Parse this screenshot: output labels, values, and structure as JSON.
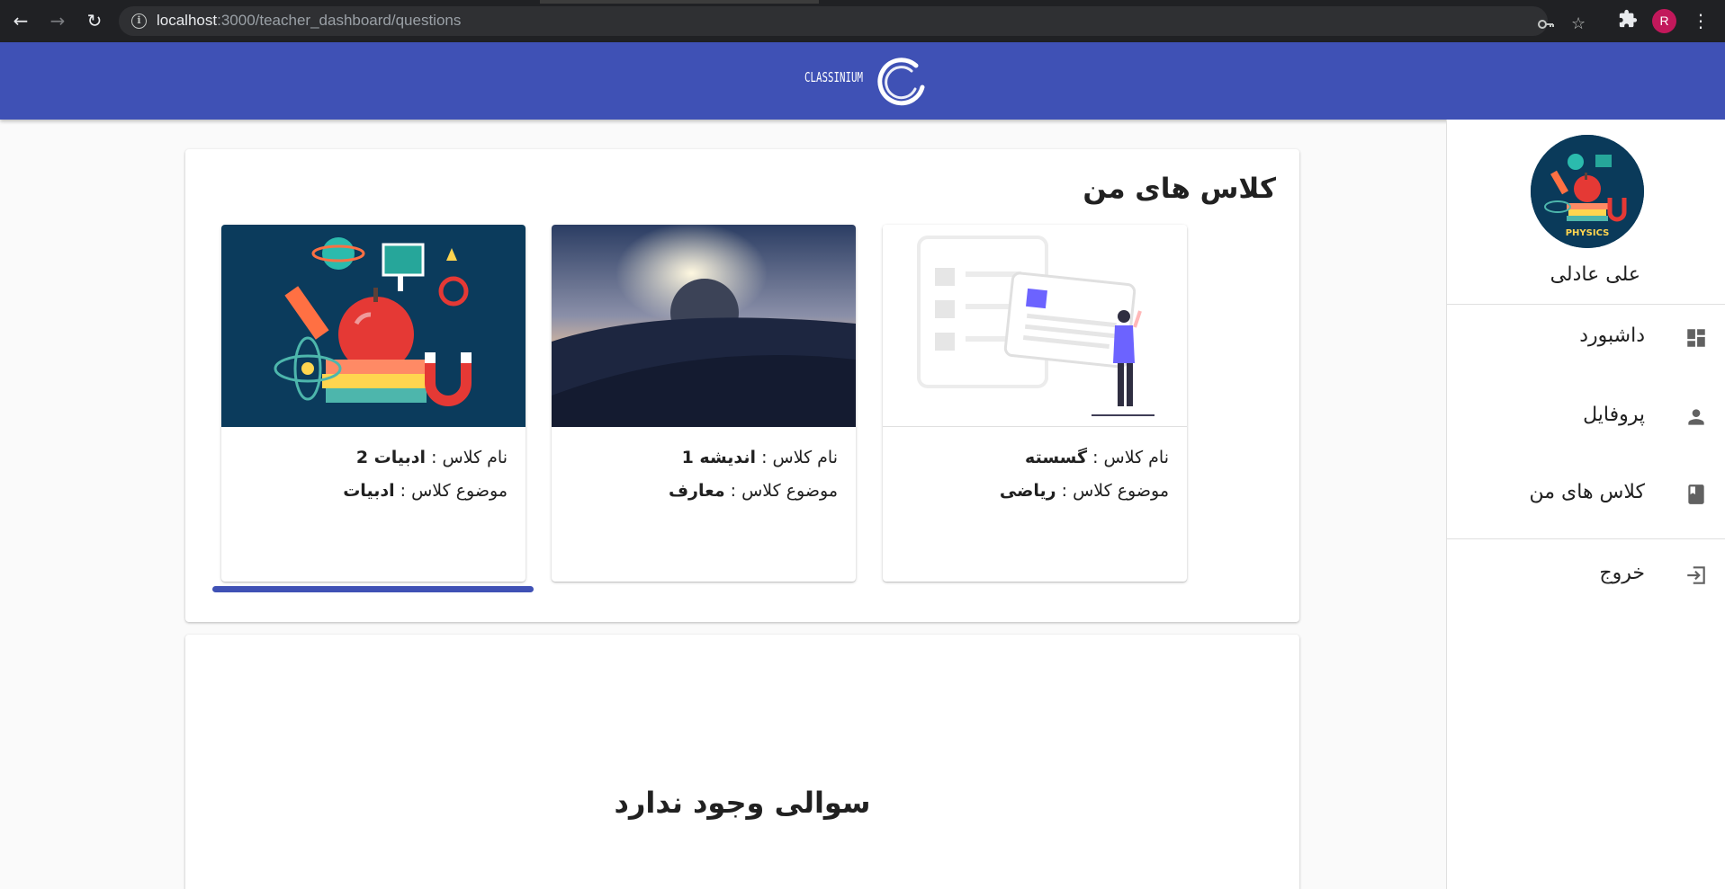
{
  "browser": {
    "url_host": "localhost",
    "url_path": ":3000/teacher_dashboard/questions",
    "profile_initial": "R",
    "icons": [
      "back-arrow-icon",
      "forward-arrow-icon",
      "reload-icon",
      "info-icon",
      "key-icon",
      "star-icon",
      "puzzle-icon",
      "kebab-menu-icon"
    ]
  },
  "header": {
    "logo_text": "CLASSINIUM",
    "brand_color": "#3f51b5"
  },
  "sidebar": {
    "user_name": "علی عادلی",
    "avatar_badge": "PHYSICS",
    "menu": [
      {
        "label": "داشبورد",
        "icon": "dashboard-icon"
      },
      {
        "label": "پروفایل",
        "icon": "person-icon"
      },
      {
        "label": "کلاس های من",
        "icon": "book-icon"
      },
      {
        "label": "خروج",
        "icon": "logout-icon"
      }
    ]
  },
  "main": {
    "classes_title": "کلاس های من",
    "class_name_label": "نام کلاس :",
    "class_topic_label": "موضوع کلاس :",
    "classes": [
      {
        "name": "گسسته",
        "topic": "ریاضی",
        "image": "illustration-person-card"
      },
      {
        "name": "اندیشه 1",
        "topic": "معارف",
        "image": "moon-desert-photo"
      },
      {
        "name": "ادبیات 2",
        "topic": "ادبیات",
        "image": "science-collage"
      }
    ],
    "empty_questions": "سوالی وجود ندارد"
  }
}
